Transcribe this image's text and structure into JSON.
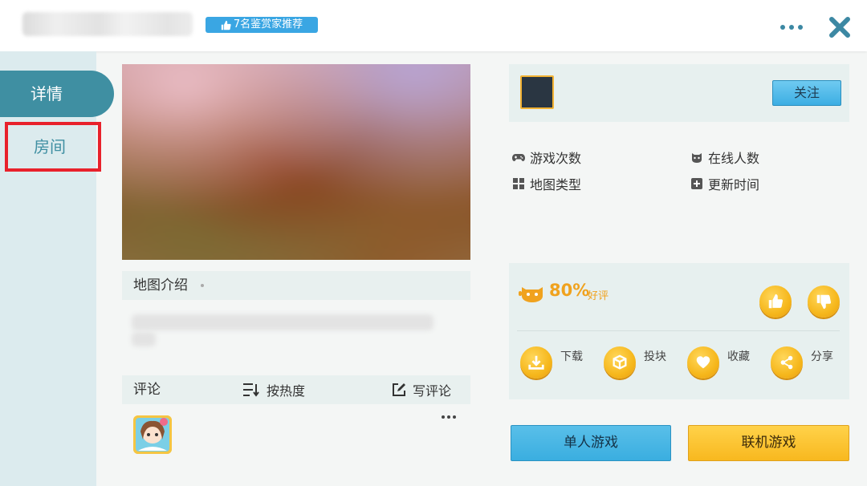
{
  "header": {
    "badge_text": "7名鉴赏家推荐",
    "accent": "#3aa6e3",
    "close_color": "#3c88a3"
  },
  "sidebar": {
    "tabs": [
      {
        "label": "详情",
        "active": true
      },
      {
        "label": "房间",
        "active": false,
        "highlighted": true
      }
    ],
    "active_color": "#3f8fa2",
    "highlight_color": "#e8212b"
  },
  "intro": {
    "title": "地图介绍"
  },
  "comments": {
    "title": "评论",
    "sort_label": "按热度",
    "write_label": "写评论"
  },
  "author": {
    "follow_label": "关注"
  },
  "stats": {
    "play_count_label": "游戏次数",
    "online_label": "在线人数",
    "map_type_label": "地图类型",
    "update_time_label": "更新时间"
  },
  "rating": {
    "percent": "80%",
    "good_label": "好评",
    "accent": "#f0a21e"
  },
  "actions": [
    {
      "label": "下载",
      "icon": "download-icon"
    },
    {
      "label": "投块",
      "icon": "block-icon"
    },
    {
      "label": "收藏",
      "icon": "heart-icon"
    },
    {
      "label": "分享",
      "icon": "share-icon"
    }
  ],
  "buttons": {
    "solo_label": "单人游戏",
    "multi_label": "联机游戏"
  }
}
